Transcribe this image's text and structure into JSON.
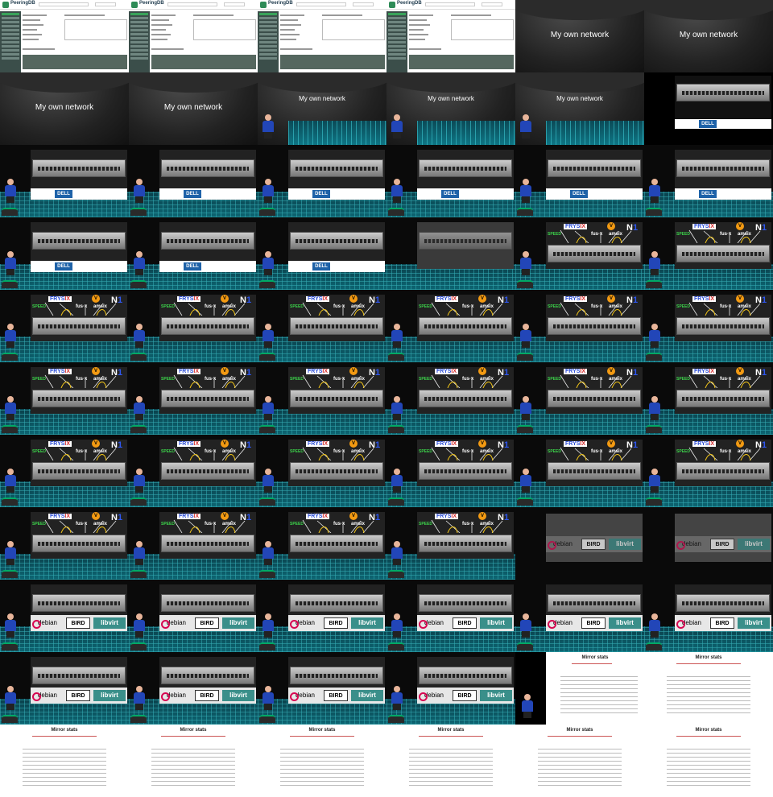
{
  "peeringdb": {
    "logo": "PeeringDB"
  },
  "title_slide": {
    "caption": "My own network"
  },
  "dell_slide": {
    "brand": "DELL"
  },
  "ix_slide": {
    "speed": "SPEED",
    "frys": "FRYS",
    "frys_ix": "IX",
    "v": "V",
    "n": "N",
    "n_mark": "1",
    "fusix": "fus·x",
    "amsix": "amsix"
  },
  "software_slide": {
    "debian": "debian",
    "bird": "BIRD",
    "libvirt": "libvirt"
  },
  "mirror_slide": {
    "title": "Mirror stats"
  },
  "grid": {
    "columns": 6,
    "rows": 11,
    "tiles": [
      "pdb",
      "pdb",
      "pdb",
      "pdb",
      "title",
      "title",
      "title",
      "title",
      "title-sm",
      "title-sm",
      "title-sm",
      "dell-empty",
      "dell",
      "dell",
      "dell",
      "dell",
      "dell",
      "dell",
      "dell",
      "dell",
      "dell",
      "dell-dark",
      "ix",
      "ix",
      "ix",
      "ix",
      "ix",
      "ix",
      "ix",
      "ix",
      "ix",
      "ix",
      "ix",
      "ix",
      "ix",
      "ix",
      "ix",
      "ix",
      "ix",
      "ix",
      "ix",
      "ix",
      "ix",
      "ix",
      "ix",
      "ix",
      "sw-bare",
      "sw-bare",
      "sw",
      "sw",
      "sw",
      "sw",
      "sw",
      "sw",
      "sw",
      "sw",
      "sw",
      "sw",
      "mirror-dark",
      "mirror",
      "mirror",
      "mirror",
      "mirror",
      "mirror",
      "mirror",
      "mirror"
    ]
  }
}
